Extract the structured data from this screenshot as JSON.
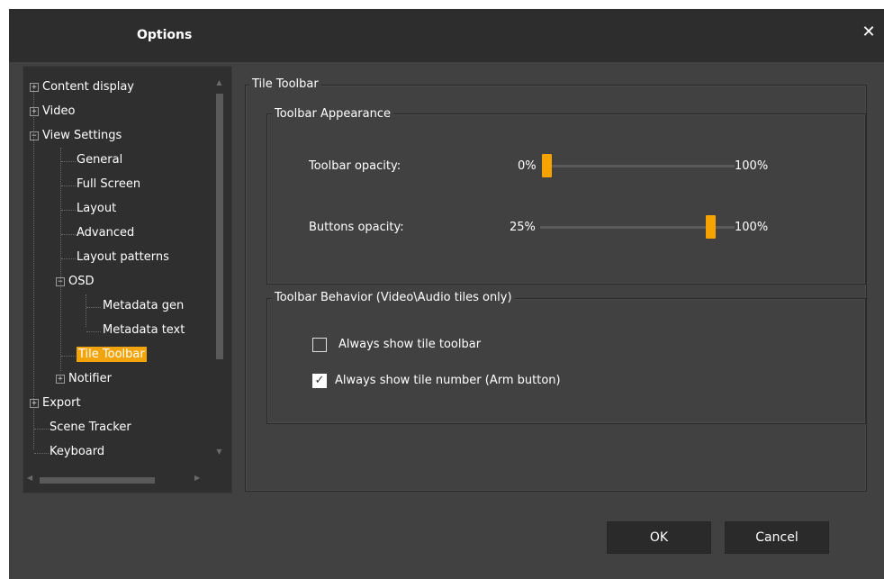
{
  "dialog": {
    "title": "Options",
    "close_glyph": "✕"
  },
  "tree": {
    "items": [
      {
        "label": "Content display",
        "expander": "+"
      },
      {
        "label": "Video",
        "expander": "+"
      },
      {
        "label": "View Settings",
        "expander": "−"
      },
      {
        "label": "General"
      },
      {
        "label": "Full Screen"
      },
      {
        "label": "Layout"
      },
      {
        "label": "Advanced"
      },
      {
        "label": "Layout patterns"
      },
      {
        "label": "OSD",
        "expander": "−"
      },
      {
        "label": "Metadata gen"
      },
      {
        "label": "Metadata text"
      },
      {
        "label": "Tile Toolbar",
        "selected": true
      },
      {
        "label": "Notifier",
        "expander": "+"
      },
      {
        "label": "Export",
        "expander": "+"
      },
      {
        "label": "Scene Tracker"
      },
      {
        "label": "Keyboard"
      }
    ]
  },
  "tile_toolbar": {
    "title": "Tile Toolbar",
    "appearance": {
      "title": "Toolbar Appearance",
      "toolbar_opacity": {
        "label": "Toolbar opacity:",
        "min_label": "0%",
        "max_label": "100%",
        "value_fraction": 0.0
      },
      "buttons_opacity": {
        "label": "Buttons opacity:",
        "min_label": "25%",
        "max_label": "100%",
        "value_fraction": 0.87
      }
    },
    "behavior": {
      "title": "Toolbar Behavior (Video\\Audio tiles only)",
      "always_show_toolbar": {
        "label": "Always show tile toolbar",
        "checked": false
      },
      "always_show_number": {
        "label": "Always show tile number (Arm button)",
        "checked": true
      }
    }
  },
  "buttons": {
    "ok": "OK",
    "cancel": "Cancel"
  },
  "colors": {
    "accent": "#f6a200",
    "background": "#414141",
    "titlebar": "#2d2d2d"
  }
}
